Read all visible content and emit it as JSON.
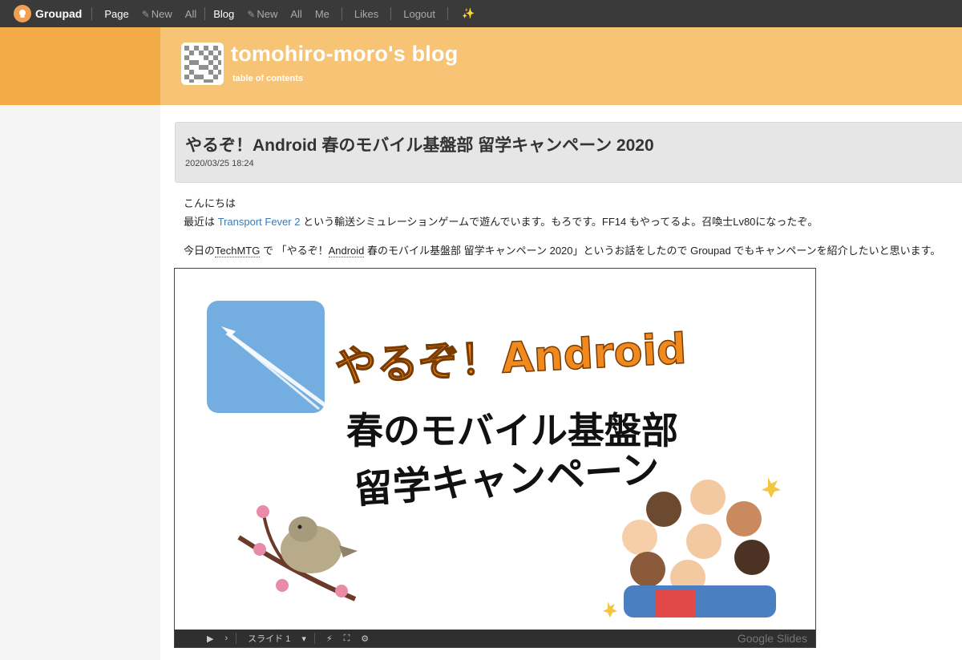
{
  "nav": {
    "brand": "Groupad",
    "page": "Page",
    "page_new": "New",
    "page_all": "All",
    "blog": "Blog",
    "blog_new": "New",
    "blog_all": "All",
    "me": "Me",
    "likes": "Likes",
    "logout": "Logout",
    "sparkle_icon": "sparkle-icon"
  },
  "header": {
    "blog_title": "tomohiro-moro's blog",
    "toc": "table of contents"
  },
  "post": {
    "title": "やるぞ！Android 春のモバイル基盤部 留学キャンペーン 2020",
    "date": "2020/03/25 18:24",
    "greeting": "こんにちは",
    "line2_pre": "最近は ",
    "line2_link": "Transport Fever 2",
    "line2_post": " という輸送シミュレーションゲームで遊んでいます。もろです。FF14 もやってるよ。召喚士Lv80になったぞ。",
    "line3_pre": "今日の",
    "line3_techmtg": "TechMTG",
    "line3_mid": " で 「やるぞ！",
    "line3_android": "Android",
    "line3_post": " 春のモバイル基盤部 留学キャンペーン 2020」というお話をしたので Groupad でもキャンペーンを紹介したいと思います。"
  },
  "slide": {
    "title_line1": "やるぞ！Android",
    "title_line2": "春のモバイル基盤部",
    "title_line3": "留学キャンペーン",
    "slide_select": "スライド 1",
    "brand": "Google Slides"
  },
  "colors": {
    "nav_bg": "#3a3a3a",
    "header_left": "#f3ab48",
    "header_band": "#f7c475",
    "link": "#3b7ab3"
  }
}
